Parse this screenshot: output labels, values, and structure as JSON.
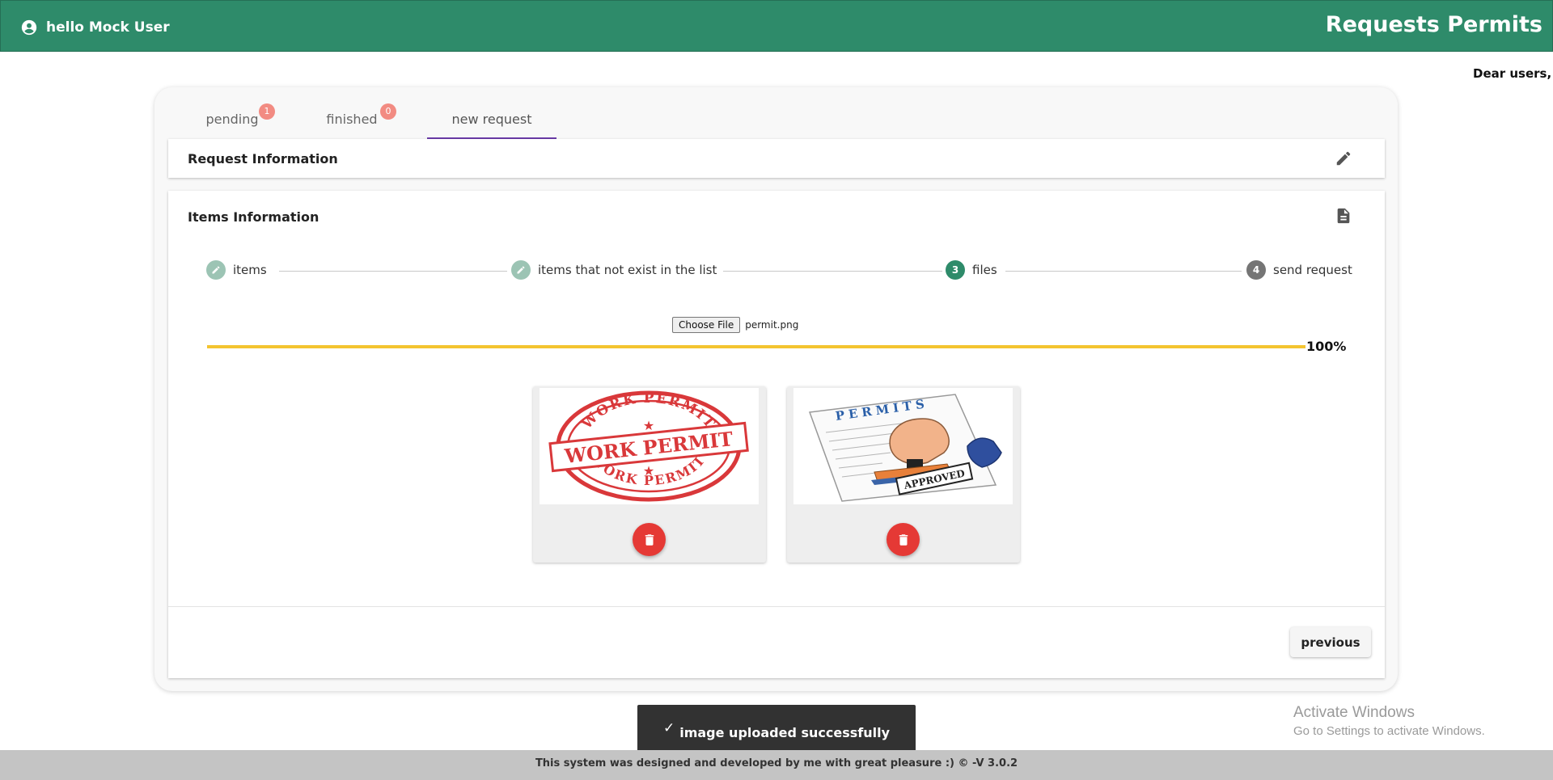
{
  "header": {
    "greeting": "hello Mock User",
    "app_title": "Requests Permits",
    "bar_color": "#2e8b6a"
  },
  "announcement": "Dear users, p",
  "tabs": [
    {
      "label": "pending",
      "badge": "1"
    },
    {
      "label": "finished",
      "badge": "0"
    },
    {
      "label": "new request",
      "active": true
    }
  ],
  "request_panel": {
    "title": "Request Information",
    "icon": "pencil-icon"
  },
  "items_panel": {
    "title": "Items Information",
    "icon": "document-icon"
  },
  "stepper": {
    "steps": [
      {
        "label": "items",
        "state": "done",
        "icon": "pencil-icon"
      },
      {
        "label": "items that not exist in the list",
        "state": "done",
        "icon": "pencil-icon"
      },
      {
        "label": "files",
        "state": "active",
        "number": "3"
      },
      {
        "label": "send request",
        "state": "pending",
        "number": "4"
      }
    ]
  },
  "upload": {
    "button_label": "Choose File",
    "file_name": "permit.png",
    "progress": 1.0,
    "progress_label": "100%",
    "progress_color": "#f4c430"
  },
  "images": [
    {
      "name": "work-permit-stamp",
      "stamp_texts": [
        "WORK PERMIT",
        "WORK PERMIT",
        "WORK PERMIT"
      ]
    },
    {
      "name": "permits-approved",
      "stamp_texts": [
        "PERMITS",
        "APPROVED"
      ]
    }
  ],
  "actions": {
    "previous_label": "previous"
  },
  "toast": {
    "message": "image uploaded successfully",
    "icon": "check-icon"
  },
  "watermark": {
    "line1": "Activate Windows",
    "line2": "Go to Settings to activate Windows."
  },
  "footer": {
    "text": "This system was designed and developed by me with great pleasure :) © -V 3.0.2"
  }
}
